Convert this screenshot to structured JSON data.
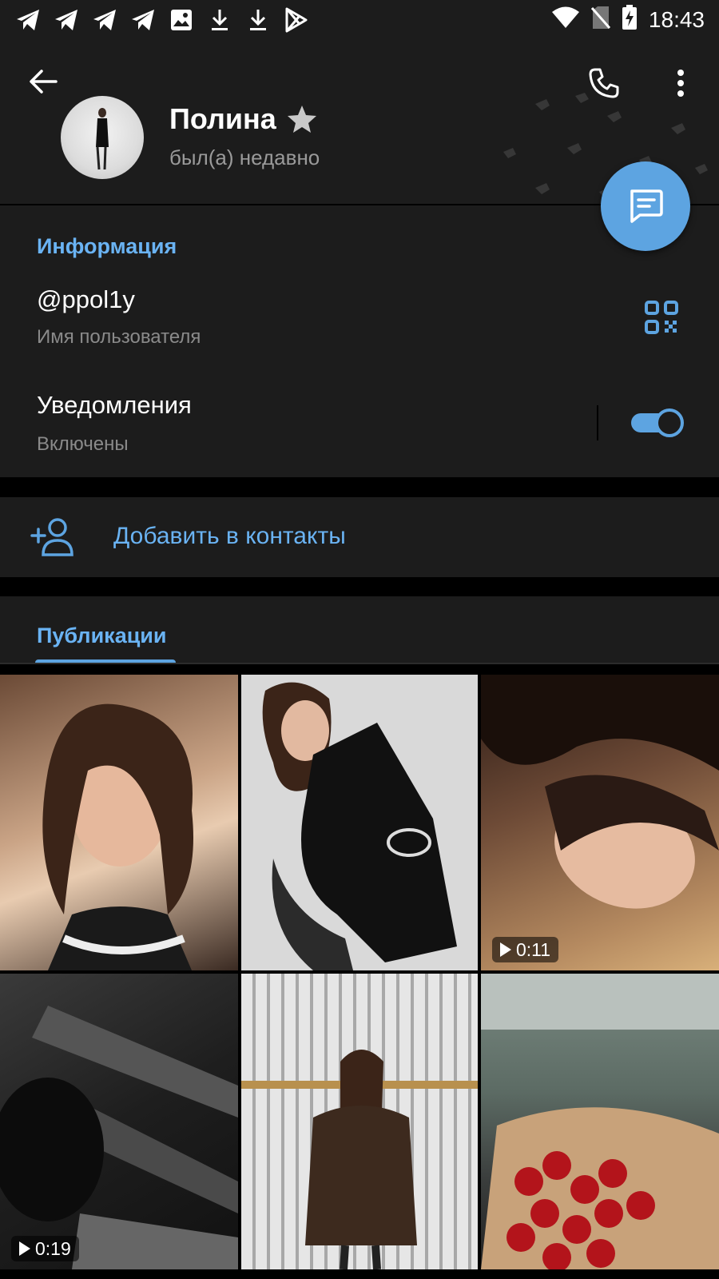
{
  "status_bar": {
    "time": "18:43",
    "left_icons": [
      "telegram-icon",
      "telegram-icon",
      "telegram-icon",
      "telegram-icon",
      "image-icon",
      "download-icon",
      "download-icon",
      "play-store-icon"
    ],
    "right_icons": [
      "wifi-icon",
      "no-sim-icon",
      "battery-charging-icon"
    ]
  },
  "header": {
    "name": "Полина",
    "status": "был(а) недавно"
  },
  "info": {
    "section_title": "Информация",
    "username": "@ppol1y",
    "username_label": "Имя пользователя",
    "notifications_label": "Уведомления",
    "notifications_status": "Включены",
    "notifications_enabled": true
  },
  "add_contact": {
    "label": "Добавить в контакты"
  },
  "media": {
    "tab_label": "Публикации",
    "tiles": [
      {
        "type": "photo"
      },
      {
        "type": "photo"
      },
      {
        "type": "video",
        "duration": "0:11"
      },
      {
        "type": "video",
        "duration": "0:19"
      },
      {
        "type": "photo"
      },
      {
        "type": "photo"
      }
    ]
  },
  "colors": {
    "accent": "#6ab3f3",
    "fab": "#5da4e1",
    "surface": "#1c1c1c",
    "background": "#000000",
    "secondary_text": "#8a8a8a"
  }
}
